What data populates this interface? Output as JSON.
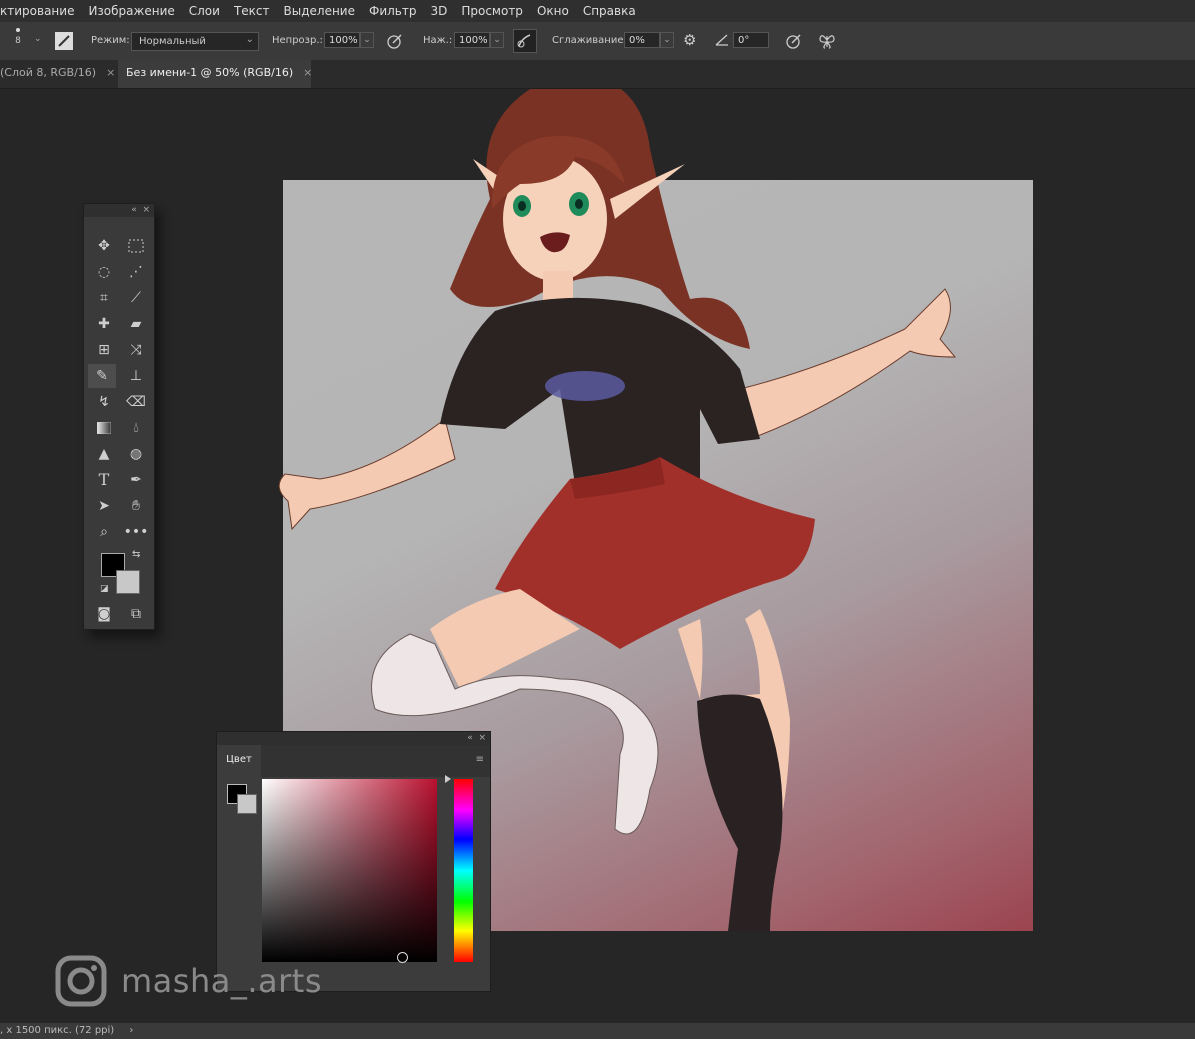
{
  "menu": [
    "ктирование",
    "Изображение",
    "Слои",
    "Текст",
    "Выделение",
    "Фильтр",
    "3D",
    "Просмотр",
    "Окно",
    "Справка"
  ],
  "options": {
    "brush_size": "8",
    "mode_label": "Режим:",
    "mode_value": "Нормальный",
    "opacity_label": "Непрозр.:",
    "opacity_value": "100%",
    "pressure_label": "Наж.:",
    "pressure_value": "100%",
    "smoothing_label": "Сглаживание:",
    "smoothing_value": "0%",
    "angle_value": "0°"
  },
  "tabs": [
    {
      "label": "(Слой 8, RGB/16)",
      "close": "×",
      "active": false
    },
    {
      "label": "Без имени-1 @ 50% (RGB/16)",
      "close": "×",
      "active": true
    }
  ],
  "toolbox": {
    "collapse": "«",
    "close": "×"
  },
  "color_panel": {
    "tab_label": "Цвет",
    "collapse": "«",
    "close": "×"
  },
  "status": {
    "text": ", x 1500 пикс. (72 ppi)",
    "arrow": "›"
  },
  "watermark": {
    "text": "masha_.arts"
  },
  "colors": {
    "foreground": "#000000",
    "background": "#c8c8c8",
    "accent_hue": "#b8102e"
  }
}
